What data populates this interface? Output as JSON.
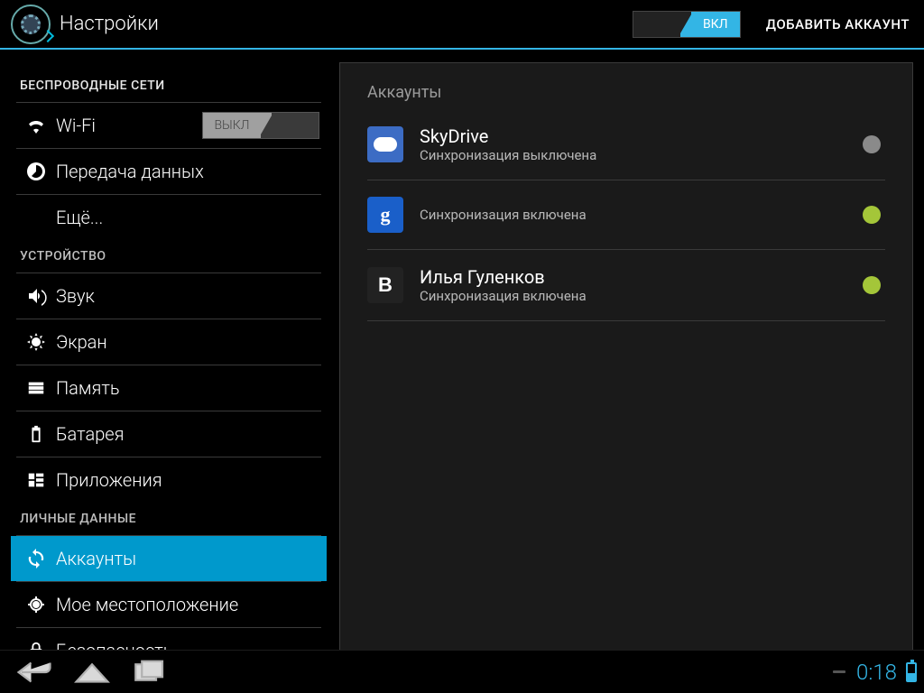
{
  "header": {
    "title": "Настройки",
    "toggle_label": "ВКЛ",
    "add_account": "ДОБАВИТЬ АККАУНТ"
  },
  "sidebar": {
    "section_wireless": "БЕСПРОВОДНЫЕ СЕТИ",
    "wifi_label": "Wi-Fi",
    "wifi_toggle": "ВЫКЛ",
    "data_usage": "Передача данных",
    "more": "Ещё...",
    "section_device": "УСТРОЙСТВО",
    "sound": "Звук",
    "display": "Экран",
    "storage": "Память",
    "battery": "Батарея",
    "apps": "Приложения",
    "section_personal": "ЛИЧНЫЕ ДАННЫЕ",
    "accounts": "Аккаунты",
    "location": "Мое местоположение",
    "security": "Безопасность"
  },
  "main": {
    "header": "Аккаунты",
    "accounts": [
      {
        "title": "SkyDrive",
        "subtitle": "Синхронизация выключена",
        "icon_letter": "",
        "sync": "off"
      },
      {
        "title": "",
        "subtitle": "Синхронизация включена",
        "icon_letter": "g",
        "sync": "on"
      },
      {
        "title": "Илья Гуленков",
        "subtitle": "Синхронизация включена",
        "icon_letter": "B",
        "sync": "on"
      }
    ]
  },
  "statusbar": {
    "time": "0:18"
  },
  "colors": {
    "accent": "#33b5e5",
    "sync_on": "#a4c639",
    "sync_off": "#8a8a8a"
  }
}
